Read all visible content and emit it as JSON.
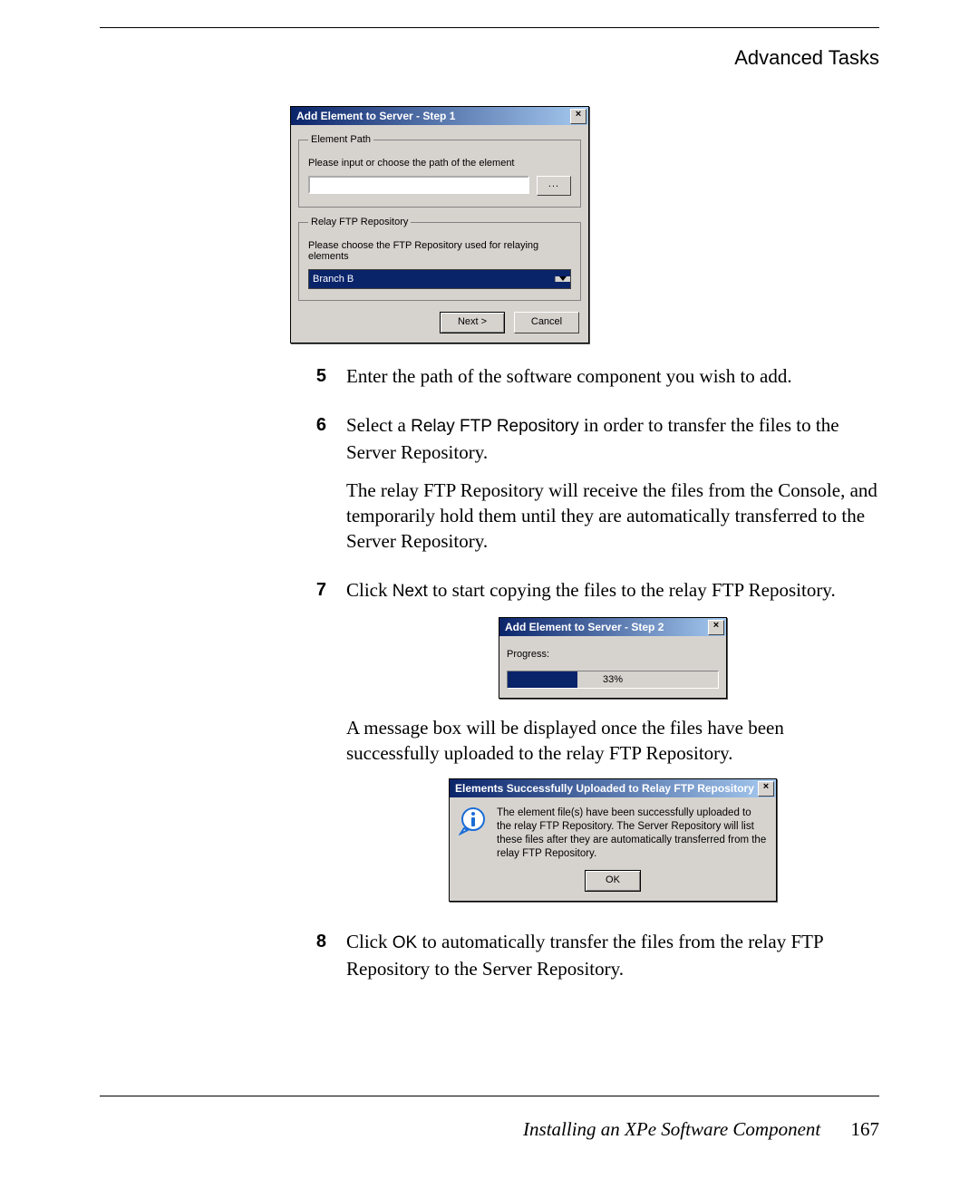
{
  "header": {
    "title": "Advanced Tasks"
  },
  "dialog1": {
    "title": "Add Element to Server - Step 1",
    "close": "×",
    "group_element_path": {
      "legend": "Element Path",
      "instruction": "Please input or choose the path of the element",
      "browse_label": "..."
    },
    "group_relay": {
      "legend": "Relay FTP Repository",
      "instruction": "Please choose the FTP Repository used for relaying elements",
      "selected": "Branch B"
    },
    "buttons": {
      "next": "Next >",
      "cancel": "Cancel"
    }
  },
  "steps": {
    "s5": {
      "num": "5",
      "text": "Enter the path of the software component you wish to add."
    },
    "s6": {
      "num": "6",
      "text_a": "Select a ",
      "ui": "Relay FTP Repository",
      "text_b": " in order to transfer the files to the Server Repository.",
      "para2": "The relay FTP Repository will receive the files from the Console, and temporarily hold them until they are automatically transferred to the Server Repository."
    },
    "s7": {
      "num": "7",
      "text_a": "Click ",
      "ui": "Next",
      "text_b": " to start copying the files to the relay FTP Repository."
    },
    "s8": {
      "num": "8",
      "text_a": "Click ",
      "ui": "OK",
      "text_b": " to automatically transfer the files from the relay FTP Repository to the Server Repository."
    },
    "after7": "A message box will be displayed once the files have been successfully uploaded to the relay FTP Repository."
  },
  "dialog2": {
    "title": "Add Element to Server - Step 2",
    "close": "×",
    "progress_label": "Progress:",
    "progress_value": 33,
    "progress_text": "33%"
  },
  "dialog3": {
    "title": "Elements Successfully Uploaded to Relay FTP Repository",
    "close": "×",
    "body": "The element file(s) have been successfully uploaded to the relay FTP Repository. The Server Repository will list these files after they are automatically transferred from the relay FTP Repository.",
    "ok": "OK"
  },
  "footer": {
    "section": "Installing an XPe Software Component",
    "page": "167"
  }
}
